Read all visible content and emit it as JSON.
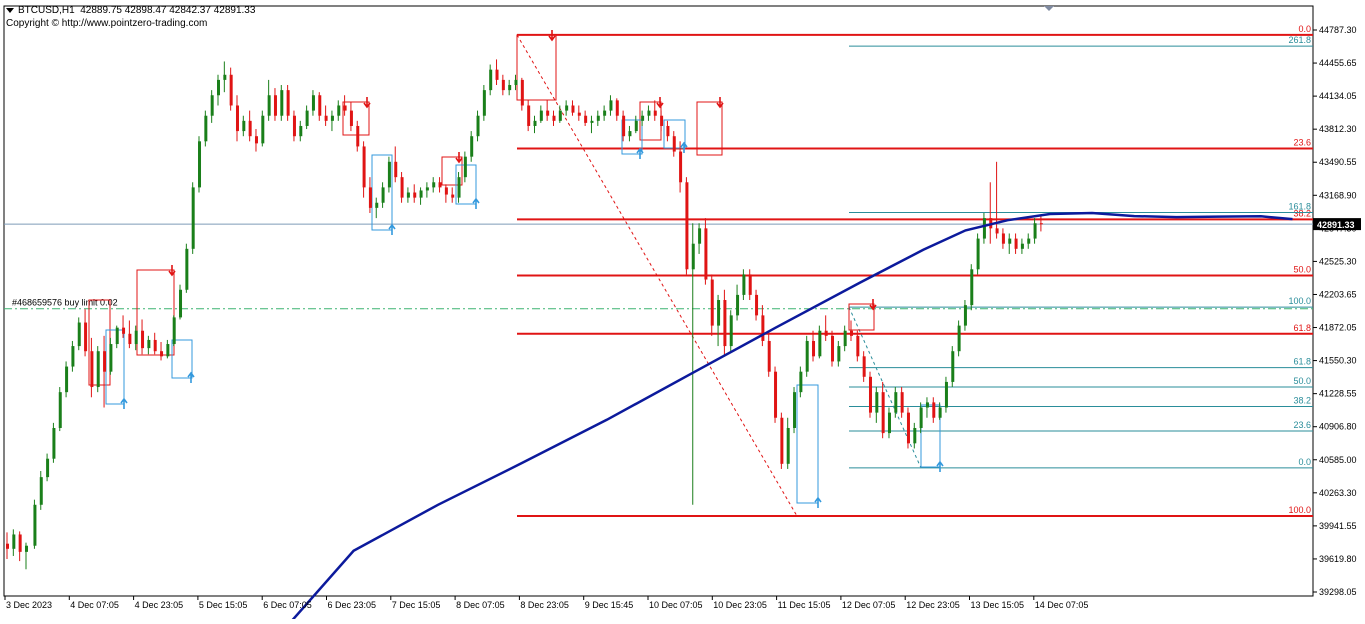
{
  "header": {
    "symbol": "BTCUSD,H1",
    "ohlc": "42889.75 42898.47 42842.37 42891.33",
    "copyright": "Copyright © http://www.pointzero-trading.com"
  },
  "colors": {
    "bull": "#1a7f1a",
    "bear": "#e01414",
    "ma": "#0c1a9c",
    "level": "#e01414",
    "fib": "#2a8d9a",
    "price_line": "#7e9bb8",
    "order_line": "#3cb371",
    "label_fib": "#2a8d9a",
    "label_level": "#e01414"
  },
  "chart_data": {
    "type": "candlestick",
    "symbol": "BTCUSD",
    "timeframe": "H1",
    "last_price": "42891.33",
    "ylim": [
      39298.05,
      44787.3
    ],
    "y_ticks": [
      "44787.30",
      "44455.65",
      "44134.05",
      "43812.30",
      "43490.55",
      "43168.90",
      "42847.30",
      "42525.30",
      "42203.65",
      "41872.05",
      "41550.30",
      "41228.55",
      "40906.80",
      "40585.00",
      "40263.30",
      "39941.55",
      "39619.80",
      "39298.05"
    ],
    "x_tick_labels": [
      "3 Dec 2023",
      "4 Dec 07:05",
      "4 Dec 23:05",
      "5 Dec 15:05",
      "6 Dec 07:05",
      "6 Dec 23:05",
      "7 Dec 15:05",
      "8 Dec 07:05",
      "8 Dec 23:05",
      "9 Dec 15:45",
      "10 Dec 07:05",
      "10 Dec 23:05",
      "11 Dec 15:05",
      "12 Dec 07:05",
      "12 Dec 23:05",
      "13 Dec 15:05",
      "14 Dec 07:05"
    ],
    "order_line": {
      "label": "#468659576 buy limit 0.02",
      "price": 42065
    },
    "major_fib": [
      {
        "label": "0.0",
        "price": 44740
      },
      {
        "label": "23.6",
        "price": 43630
      },
      {
        "label": "38.2",
        "price": 42938
      },
      {
        "label": "50.0",
        "price": 42390
      },
      {
        "label": "61.8",
        "price": 41820
      },
      {
        "label": "100.0",
        "price": 40040
      }
    ],
    "minor_fib": [
      {
        "label": "261.8",
        "price": 44630
      },
      {
        "label": "161.8",
        "price": 43005
      },
      {
        "label": "100.0",
        "price": 42080
      },
      {
        "label": "61.8",
        "price": 41490
      },
      {
        "label": "50.0",
        "price": 41300
      },
      {
        "label": "38.2",
        "price": 41110
      },
      {
        "label": "23.6",
        "price": 40870
      },
      {
        "label": "0.0",
        "price": 40510
      }
    ],
    "ma_points": [
      [
        30,
        39000
      ],
      [
        60,
        39700
      ],
      [
        100,
        40150
      ],
      [
        140,
        40560
      ],
      [
        180,
        40980
      ],
      [
        220,
        41430
      ],
      [
        260,
        41880
      ],
      [
        300,
        42320
      ],
      [
        330,
        42640
      ],
      [
        350,
        42830
      ],
      [
        370,
        42930
      ],
      [
        390,
        42990
      ],
      [
        410,
        43000
      ],
      [
        430,
        42970
      ],
      [
        450,
        42960
      ],
      [
        470,
        42965
      ],
      [
        490,
        42968
      ],
      [
        505,
        42940
      ]
    ],
    "candles": [
      [
        0,
        39770,
        39880,
        39620,
        39720
      ],
      [
        3,
        39720,
        39910,
        39650,
        39860
      ],
      [
        6,
        39860,
        39890,
        39600,
        39690
      ],
      [
        9,
        39690,
        39780,
        39520,
        39750
      ],
      [
        13,
        39750,
        40200,
        39720,
        40150
      ],
      [
        16,
        40150,
        40480,
        40100,
        40420
      ],
      [
        19,
        40420,
        40650,
        40380,
        40600
      ],
      [
        22,
        40600,
        40950,
        40560,
        40900
      ],
      [
        25,
        40900,
        41300,
        40870,
        41250
      ],
      [
        28,
        41250,
        41550,
        41200,
        41500
      ],
      [
        31,
        41500,
        41750,
        41450,
        41700
      ],
      [
        34,
        41700,
        41980,
        41660,
        41930
      ],
      [
        37,
        41930,
        42060,
        41600,
        41650
      ],
      [
        40,
        41650,
        41780,
        41200,
        41300
      ],
      [
        43,
        41300,
        41700,
        41250,
        41650
      ],
      [
        46,
        41650,
        41800,
        41100,
        41450
      ],
      [
        49,
        41450,
        41780,
        41420,
        41720
      ],
      [
        52,
        41720,
        41900,
        41680,
        41880
      ],
      [
        55,
        41880,
        42000,
        41780,
        41820
      ],
      [
        58,
        41820,
        41950,
        41680,
        41720
      ],
      [
        61,
        41720,
        41900,
        41660,
        41850
      ],
      [
        64,
        41850,
        41960,
        41620,
        41680
      ],
      [
        67,
        41680,
        41800,
        41620,
        41760
      ],
      [
        70,
        41760,
        41830,
        41620,
        41650
      ],
      [
        73,
        41650,
        41740,
        41560,
        41600
      ],
      [
        76,
        41600,
        41760,
        41580,
        41720
      ],
      [
        79,
        41720,
        42000,
        41700,
        41980
      ],
      [
        82,
        41980,
        42300,
        41960,
        42250
      ],
      [
        85,
        42250,
        42700,
        42220,
        42650
      ],
      [
        88,
        42650,
        43300,
        42600,
        43250
      ],
      [
        91,
        43250,
        43750,
        43200,
        43700
      ],
      [
        94,
        43700,
        44000,
        43650,
        43950
      ],
      [
        97,
        43950,
        44200,
        43880,
        44150
      ],
      [
        100,
        44150,
        44350,
        44050,
        44300
      ],
      [
        103,
        44300,
        44480,
        44180,
        44350
      ],
      [
        106,
        44350,
        44420,
        44000,
        44050
      ],
      [
        109,
        44050,
        44150,
        43700,
        43800
      ],
      [
        112,
        43800,
        43950,
        43750,
        43900
      ],
      [
        115,
        43900,
        44000,
        43700,
        43750
      ],
      [
        118,
        43750,
        43820,
        43600,
        43680
      ],
      [
        121,
        43680,
        44000,
        43650,
        43950
      ],
      [
        124,
        43950,
        44300,
        43900,
        44150
      ],
      [
        127,
        44150,
        44220,
        43900,
        43950
      ],
      [
        130,
        43950,
        44250,
        43900,
        44200
      ],
      [
        133,
        44200,
        44250,
        43900,
        43950
      ],
      [
        136,
        43950,
        44000,
        43700,
        43750
      ],
      [
        139,
        43750,
        43900,
        43700,
        43850
      ],
      [
        142,
        43850,
        44050,
        43820,
        44000
      ],
      [
        145,
        44000,
        44200,
        43950,
        44150
      ],
      [
        148,
        44150,
        44180,
        43900,
        43950
      ],
      [
        151,
        43950,
        44050,
        43850,
        43900
      ],
      [
        154,
        43900,
        44000,
        43800,
        43950
      ],
      [
        157,
        43950,
        44100,
        43900,
        44050
      ],
      [
        160,
        44050,
        44150,
        43950,
        44000
      ],
      [
        163,
        44000,
        44080,
        43800,
        43850
      ],
      [
        166,
        43850,
        43900,
        43600,
        43650
      ],
      [
        169,
        43650,
        43700,
        43150,
        43250
      ],
      [
        172,
        43250,
        43350,
        43000,
        43050
      ],
      [
        175,
        43050,
        43150,
        42950,
        43100
      ],
      [
        178,
        43100,
        43300,
        43050,
        43250
      ],
      [
        181,
        43250,
        43550,
        43200,
        43500
      ],
      [
        184,
        43500,
        43650,
        43300,
        43350
      ],
      [
        187,
        43350,
        43400,
        43100,
        43150
      ],
      [
        190,
        43150,
        43250,
        43100,
        43200
      ],
      [
        193,
        43200,
        43280,
        43100,
        43150
      ],
      [
        196,
        43150,
        43250,
        43080,
        43220
      ],
      [
        199,
        43220,
        43300,
        43150,
        43250
      ],
      [
        202,
        43250,
        43350,
        43200,
        43300
      ],
      [
        205,
        43300,
        43350,
        43200,
        43250
      ],
      [
        208,
        43250,
        43280,
        43100,
        43180
      ],
      [
        211,
        43180,
        43250,
        43100,
        43150
      ],
      [
        214,
        43150,
        43400,
        43100,
        43350
      ],
      [
        217,
        43350,
        43600,
        43300,
        43550
      ],
      [
        220,
        43550,
        43800,
        43500,
        43750
      ],
      [
        223,
        43750,
        44000,
        43700,
        43950
      ],
      [
        226,
        43950,
        44250,
        43900,
        44200
      ],
      [
        229,
        44200,
        44450,
        44150,
        44400
      ],
      [
        232,
        44400,
        44500,
        44250,
        44300
      ],
      [
        235,
        44300,
        44350,
        44150,
        44200
      ],
      [
        238,
        44200,
        44300,
        44150,
        44250
      ],
      [
        241,
        44250,
        44350,
        44200,
        44300
      ],
      [
        244,
        44300,
        44320,
        44000,
        44050
      ],
      [
        247,
        44050,
        44100,
        43800,
        43850
      ],
      [
        250,
        43850,
        43950,
        43780,
        43900
      ],
      [
        253,
        43900,
        44050,
        43880,
        44000
      ],
      [
        256,
        44000,
        44100,
        43900,
        43950
      ],
      [
        259,
        43950,
        44000,
        43850,
        43900
      ],
      [
        262,
        43900,
        44050,
        43880,
        44000
      ],
      [
        265,
        44000,
        44100,
        43950,
        44050
      ],
      [
        268,
        44050,
        44100,
        43950,
        43980
      ],
      [
        271,
        43980,
        44050,
        43900,
        43950
      ],
      [
        274,
        43950,
        44000,
        43850,
        43880
      ],
      [
        277,
        43880,
        43950,
        43780,
        43900
      ],
      [
        280,
        43900,
        44000,
        43850,
        43950
      ],
      [
        283,
        43950,
        44050,
        43900,
        44000
      ],
      [
        286,
        44000,
        44150,
        43950,
        44100
      ],
      [
        289,
        44100,
        44120,
        43900,
        43950
      ],
      [
        292,
        43950,
        44000,
        43700,
        43750
      ],
      [
        295,
        43750,
        43850,
        43700,
        43800
      ],
      [
        298,
        43800,
        43950,
        43780,
        43900
      ],
      [
        301,
        43900,
        44000,
        43850,
        43950
      ],
      [
        304,
        43950,
        44050,
        43900,
        44000
      ],
      [
        307,
        44000,
        44100,
        43900,
        43950
      ],
      [
        310,
        43950,
        44000,
        43800,
        43850
      ],
      [
        313,
        43850,
        43900,
        43700,
        43750
      ],
      [
        316,
        43750,
        43800,
        43550,
        43600
      ],
      [
        319,
        43600,
        43700,
        43200,
        43300
      ],
      [
        322,
        43300,
        43350,
        42400,
        42450
      ],
      [
        325,
        42450,
        42900,
        40150,
        42700
      ],
      [
        328,
        42700,
        42900,
        42600,
        42850
      ],
      [
        331,
        42850,
        42950,
        42300,
        42350
      ],
      [
        334,
        42350,
        42400,
        41800,
        41900
      ],
      [
        337,
        41900,
        42200,
        41700,
        42150
      ],
      [
        340,
        42150,
        42250,
        41600,
        41700
      ],
      [
        343,
        41700,
        42050,
        41650,
        42000
      ],
      [
        346,
        42000,
        42300,
        41950,
        42200
      ],
      [
        349,
        42200,
        42450,
        42150,
        42400
      ],
      [
        352,
        42400,
        42450,
        42150,
        42200
      ],
      [
        355,
        42200,
        42250,
        41950,
        42000
      ],
      [
        358,
        42000,
        42100,
        41700,
        41750
      ],
      [
        361,
        41750,
        41850,
        41400,
        41450
      ],
      [
        364,
        41450,
        41500,
        40950,
        41000
      ],
      [
        367,
        41000,
        41050,
        40500,
        40550
      ],
      [
        370,
        40550,
        41000,
        40500,
        40900
      ],
      [
        373,
        40900,
        41300,
        40850,
        41250
      ],
      [
        376,
        41250,
        41500,
        41200,
        41450
      ],
      [
        379,
        41450,
        41800,
        41400,
        41750
      ],
      [
        382,
        41750,
        41850,
        41550,
        41600
      ],
      [
        385,
        41600,
        41900,
        41580,
        41850
      ],
      [
        388,
        41850,
        42000,
        41750,
        41800
      ],
      [
        391,
        41800,
        41850,
        41500,
        41550
      ],
      [
        394,
        41550,
        41750,
        41500,
        41700
      ],
      [
        397,
        41700,
        41900,
        41650,
        41850
      ],
      [
        400,
        41850,
        41950,
        41750,
        41800
      ],
      [
        403,
        41800,
        41850,
        41550,
        41600
      ],
      [
        406,
        41600,
        41650,
        41350,
        41400
      ],
      [
        409,
        41400,
        41450,
        41000,
        41050
      ],
      [
        412,
        41050,
        41300,
        40950,
        41250
      ],
      [
        415,
        41250,
        41350,
        40800,
        40850
      ],
      [
        418,
        40850,
        41100,
        40800,
        41050
      ],
      [
        421,
        41050,
        41300,
        41000,
        41250
      ],
      [
        424,
        41250,
        41300,
        41000,
        41050
      ],
      [
        427,
        41050,
        41100,
        40700,
        40750
      ],
      [
        430,
        40750,
        40950,
        40700,
        40900
      ],
      [
        433,
        40900,
        41150,
        40850,
        41100
      ],
      [
        436,
        41100,
        41200,
        41000,
        41150
      ],
      [
        439,
        41150,
        41200,
        40950,
        41000
      ],
      [
        442,
        41000,
        41150,
        40980,
        41100
      ],
      [
        445,
        41100,
        41400,
        41050,
        41350
      ],
      [
        448,
        41350,
        41700,
        41300,
        41650
      ],
      [
        451,
        41650,
        41950,
        41600,
        41900
      ],
      [
        454,
        41900,
        42150,
        41850,
        42100
      ],
      [
        457,
        42100,
        42500,
        42050,
        42450
      ],
      [
        460,
        42450,
        42800,
        42400,
        42750
      ],
      [
        463,
        42750,
        43000,
        42700,
        42950
      ],
      [
        466,
        42950,
        43300,
        42700,
        42850
      ],
      [
        469,
        42850,
        43500,
        42750,
        42800
      ],
      [
        472,
        42800,
        42850,
        42650,
        42700
      ],
      [
        475,
        42700,
        42800,
        42600,
        42750
      ],
      [
        478,
        42750,
        42800,
        42600,
        42650
      ],
      [
        481,
        42650,
        42750,
        42600,
        42700
      ],
      [
        484,
        42700,
        42800,
        42650,
        42750
      ],
      [
        487,
        42750,
        42950,
        42700,
        42900
      ],
      [
        490,
        42900,
        42980,
        42820,
        42890
      ]
    ],
    "fractal_up": [
      [
        552,
        35
      ],
      [
        172,
        270
      ],
      [
        367,
        102
      ],
      [
        459,
        157
      ],
      [
        660,
        102
      ],
      [
        720,
        102
      ],
      [
        873,
        304
      ]
    ],
    "fractal_down": [
      [
        124,
        404
      ],
      [
        191,
        378
      ],
      [
        392,
        230
      ],
      [
        476,
        204
      ],
      [
        640,
        154
      ],
      [
        684,
        148
      ],
      [
        818,
        503
      ],
      [
        940,
        467
      ]
    ]
  }
}
